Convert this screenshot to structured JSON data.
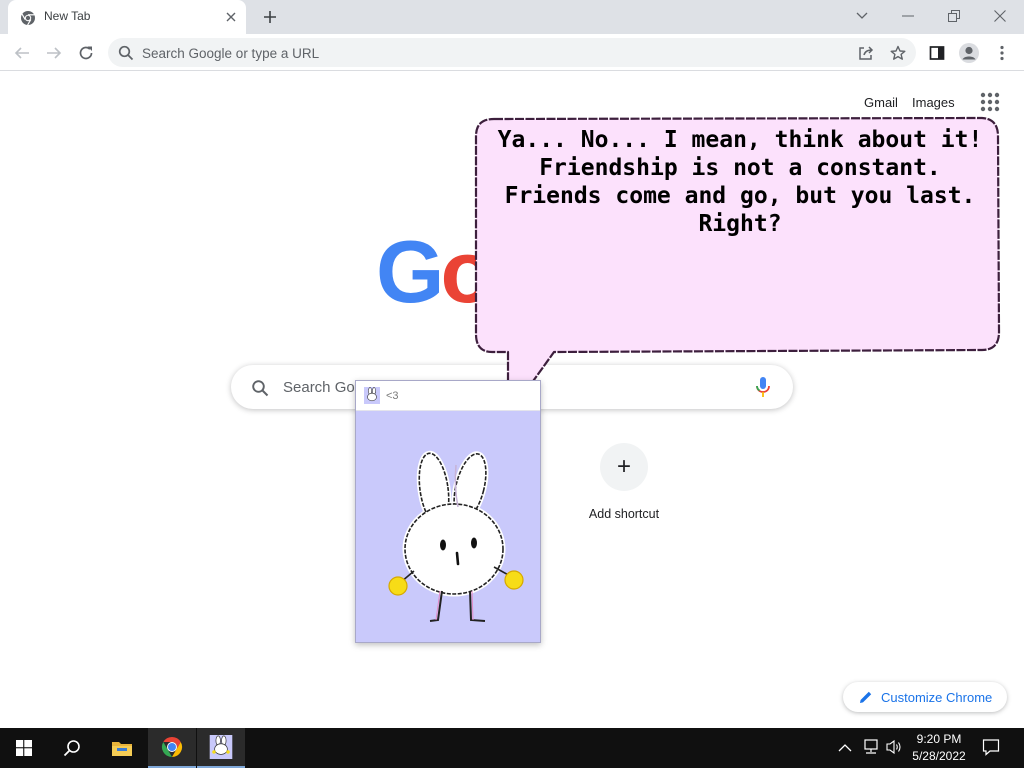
{
  "browser": {
    "tab": {
      "title": "New Tab",
      "favicon": "chrome-icon"
    },
    "omnibox": {
      "placeholder": "Search Google or type a URL"
    }
  },
  "ntp": {
    "gmail_link": "Gmail",
    "images_link": "Images",
    "logo_letters": [
      "G",
      "o"
    ],
    "search_placeholder": "Search Go",
    "shortcut": {
      "icon": "+",
      "label": "Add shortcut"
    },
    "customize_label": "Customize Chrome"
  },
  "pet_window": {
    "title": "<3",
    "character": "white bunny with yellow hands"
  },
  "speech_bubble": {
    "text": "Ya... No... I mean, think about it! Friendship is not a constant. Friends come and go, but you last. Right?"
  },
  "taskbar": {
    "time": "9:20 PM",
    "date": "5/28/2022",
    "pinned": [
      "start-icon",
      "search-icon",
      "file-explorer-icon",
      "chrome-icon",
      "bunny-app-icon"
    ]
  },
  "colors": {
    "google_blue": "#4285f4",
    "google_red": "#ea4335",
    "bubble_fill": "#fce1fc",
    "pet_background": "#c9c9fb",
    "accent": "#1a73e8"
  }
}
